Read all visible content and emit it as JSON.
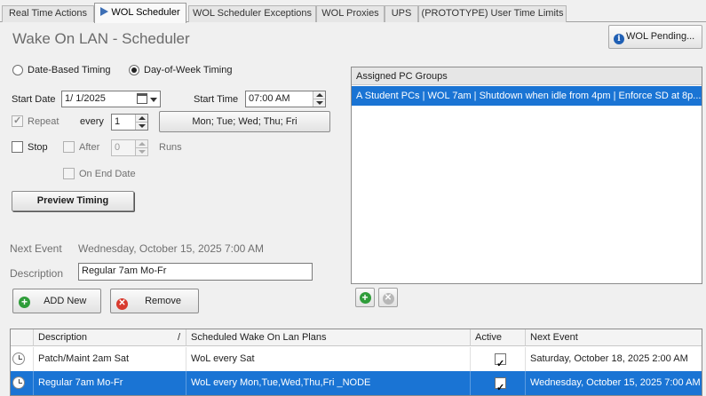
{
  "tabs": [
    {
      "label": "Real Time Actions"
    },
    {
      "label": "WOL Scheduler",
      "active": true,
      "icon": "play-arrow-icon"
    },
    {
      "label": "WOL Scheduler Exceptions"
    },
    {
      "label": "WOL Proxies"
    },
    {
      "label": "UPS"
    },
    {
      "label": "(PROTOTYPE) User Time Limits"
    }
  ],
  "header": {
    "title": "Wake On LAN - Scheduler",
    "wol_pending_label": "WOL Pending...",
    "wol_pending_icon": "info-icon"
  },
  "timing": {
    "date_based_label": "Date-Based Timing",
    "day_of_week_label": "Day-of-Week Timing",
    "selected": "Day-of-Week Timing"
  },
  "form": {
    "start_date_label": "Start Date",
    "start_date_value": "1/  1/2025",
    "start_time_label": "Start Time",
    "start_time_value": "07:00 AM",
    "repeat_label": "Repeat",
    "repeat_checked": true,
    "every_label": "every",
    "every_value": "1",
    "days_button_label": "Mon; Tue; Wed; Thu; Fri",
    "stop_label": "Stop",
    "stop_checked": false,
    "after_label": "After",
    "after_value": "0",
    "runs_label": "Runs",
    "on_end_date_label": "On End Date",
    "preview_button_label": "Preview Timing",
    "next_event_label": "Next Event",
    "next_event_value": "Wednesday, October 15, 2025 7:00 AM",
    "description_label": "Description",
    "description_value": "Regular 7am Mo-Fr",
    "add_button_label": "ADD New",
    "remove_button_label": "Remove"
  },
  "assigned_groups": {
    "header": "Assigned PC Groups",
    "items": [
      "A Student PCs | WOL 7am | Shutdown when idle from 4pm | Enforce SD at 8p..."
    ]
  },
  "schedule_table": {
    "columns": [
      "Description",
      "Scheduled Wake On Lan Plans",
      "Active",
      "Next Event"
    ],
    "sort_indicator": "/",
    "rows": [
      {
        "description": "Patch/Maint 2am Sat",
        "plan": "WoL  every Sat",
        "active": true,
        "next_event": "Saturday, October 18, 2025 2:00 AM",
        "selected": false
      },
      {
        "description": "Regular 7am Mo-Fr",
        "plan": "WoL  every Mon,Tue,Wed,Thu,Fri  _NODE",
        "active": true,
        "next_event": "Wednesday, October 15, 2025 7:00 AM",
        "selected": true
      }
    ]
  },
  "colors": {
    "selection": "#1a74d4",
    "title_grey": "#6b6b6b",
    "add_green": "#2f9d3a",
    "remove_red": "#d83a2e"
  }
}
